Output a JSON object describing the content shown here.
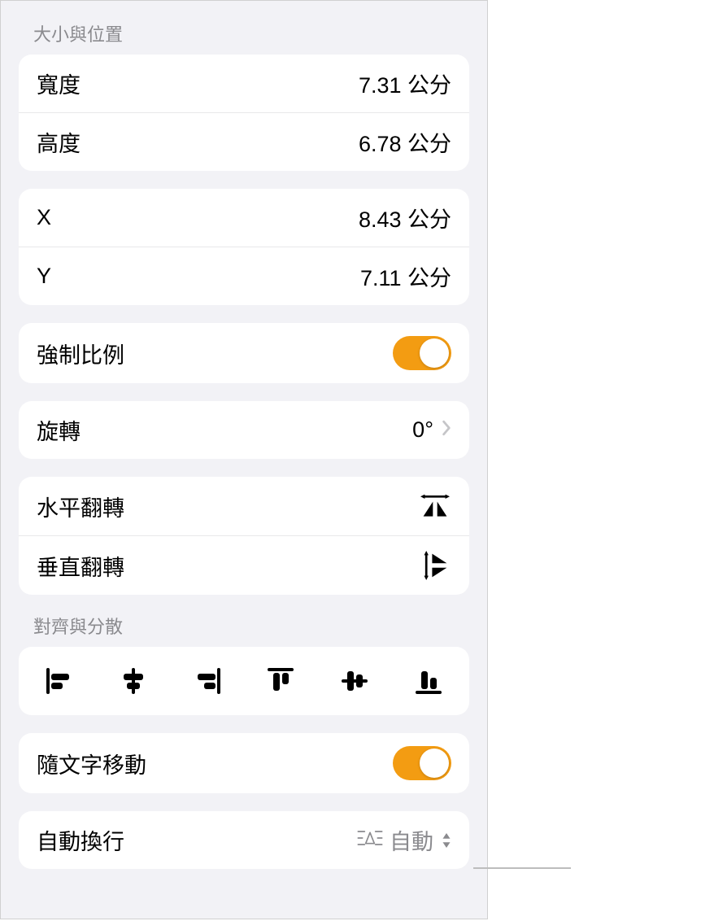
{
  "size_position": {
    "header": "大小與位置",
    "width_label": "寬度",
    "width_value": "7.31 公分",
    "height_label": "高度",
    "height_value": "6.78 公分",
    "x_label": "X",
    "x_value": "8.43 公分",
    "y_label": "Y",
    "y_value": "7.11 公分"
  },
  "constrain": {
    "label": "強制比例",
    "on": true
  },
  "rotate": {
    "label": "旋轉",
    "value": "0°"
  },
  "flip": {
    "horizontal_label": "水平翻轉",
    "vertical_label": "垂直翻轉"
  },
  "align": {
    "header": "對齊與分散"
  },
  "move_with_text": {
    "label": "隨文字移動",
    "on": true
  },
  "text_wrap": {
    "label": "自動換行",
    "value": "自動"
  }
}
